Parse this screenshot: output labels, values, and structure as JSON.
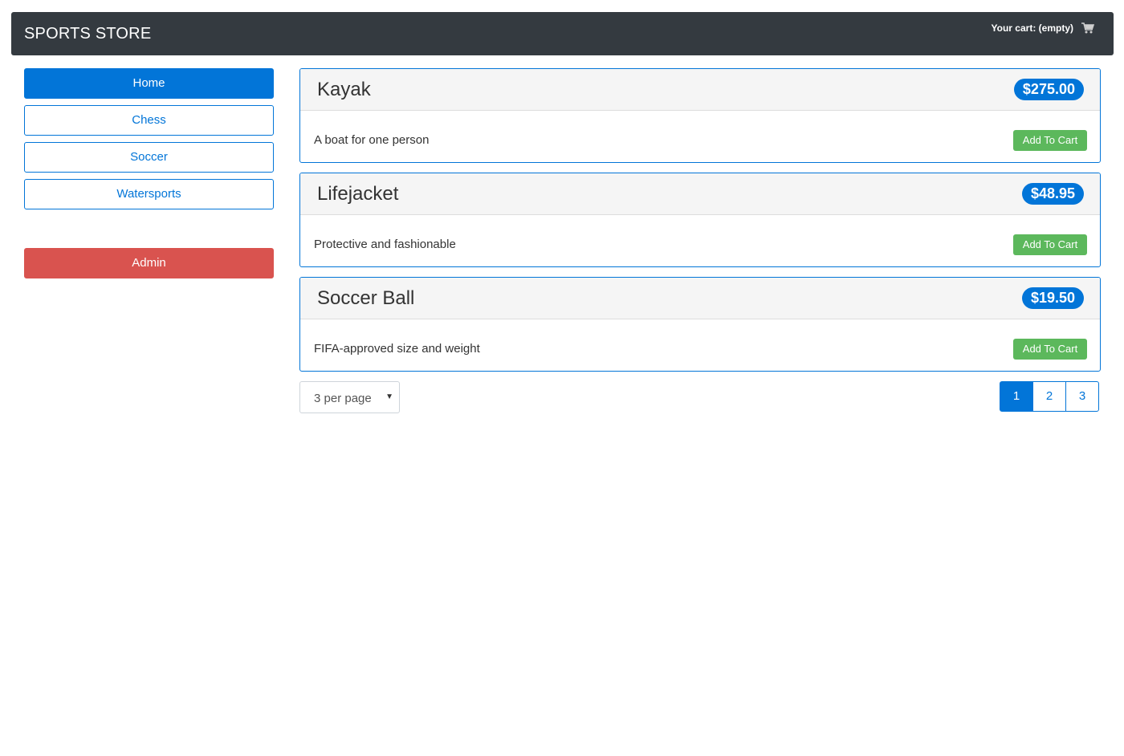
{
  "navbar": {
    "brand": "SPORTS STORE",
    "cart_text": "Your cart: (empty)",
    "cart_icon": "shopping-cart-icon"
  },
  "sidebar": {
    "categories": [
      {
        "label": "Home",
        "active": true
      },
      {
        "label": "Chess",
        "active": false
      },
      {
        "label": "Soccer",
        "active": false
      },
      {
        "label": "Watersports",
        "active": false
      }
    ],
    "admin_label": "Admin"
  },
  "products": [
    {
      "name": "Kayak",
      "price": "$275.00",
      "description": "A boat for one person",
      "button": "Add To Cart"
    },
    {
      "name": "Lifejacket",
      "price": "$48.95",
      "description": "Protective and fashionable",
      "button": "Add To Cart"
    },
    {
      "name": "Soccer Ball",
      "price": "$19.50",
      "description": "FIFA-approved size and weight",
      "button": "Add To Cart"
    }
  ],
  "per_page": {
    "selected": "3 per page"
  },
  "pagination": {
    "pages": [
      "1",
      "2",
      "3"
    ],
    "current": "1"
  },
  "colors": {
    "primary": "#0275d8",
    "navbar": "#343a40",
    "success": "#5cb85c",
    "danger": "#d9534f"
  }
}
